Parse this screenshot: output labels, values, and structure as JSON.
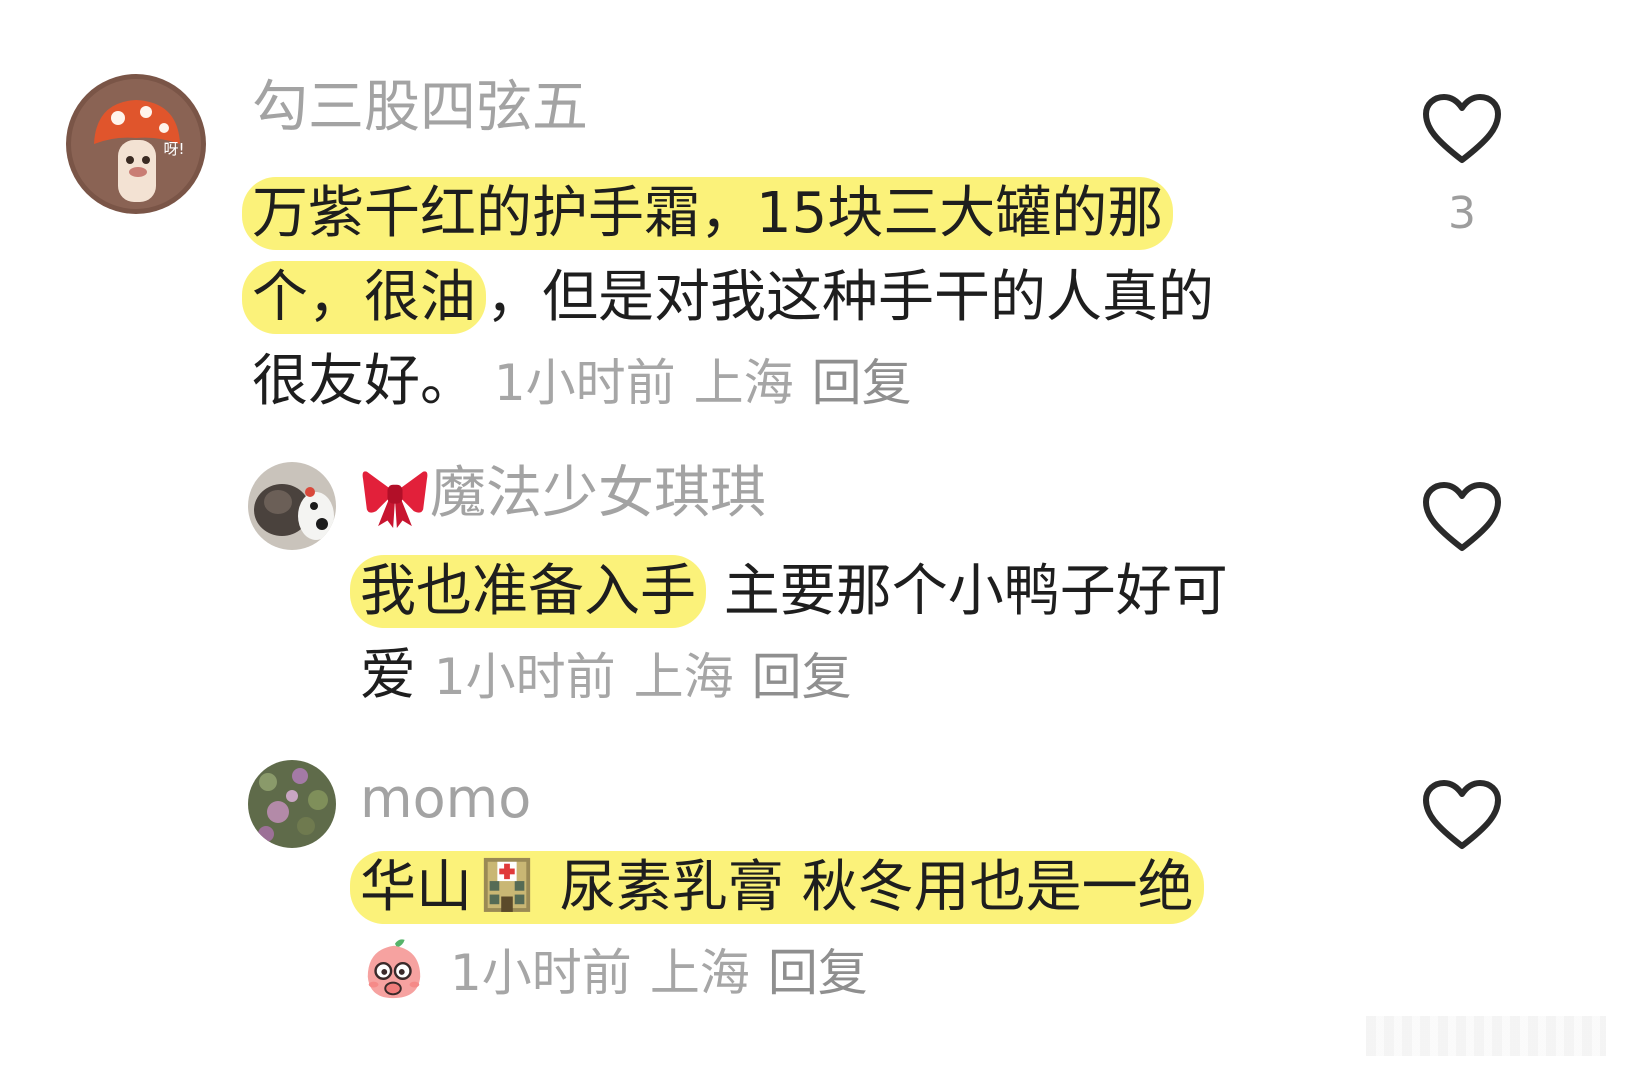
{
  "comments": [
    {
      "username": "勾三股四弦五",
      "text_highlighted_1": "万紫千红的护手霜，15块三大罐的那",
      "text_highlighted_2": "个，很油",
      "text_rest": "，但是对我这种手干的人真的",
      "text_line3": "很友好。",
      "time": "1小时前",
      "location": "上海",
      "reply_label": "回复",
      "like_count": "3",
      "avatar_text": "呀!"
    },
    {
      "username_emoji": "🎀",
      "username": "魔法少女琪琪",
      "text_highlighted": "我也准备入手",
      "text_rest": " 主要那个小鸭子好可",
      "text_line2": "爱",
      "time": "1小时前",
      "location": "上海",
      "reply_label": "回复",
      "like_count": ""
    },
    {
      "username": "momo",
      "text_part1": "华山",
      "text_part2": " 尿素乳膏 秋冬用也是一绝",
      "time": "1小时前",
      "location": "上海",
      "reply_label": "回复",
      "like_count": ""
    }
  ],
  "icons": {
    "like": "heart-outline-icon",
    "hospital": "hospital-icon",
    "sticker": "peach-sticker-icon",
    "bow": "ribbon-bow-icon"
  },
  "colors": {
    "highlight": "#fbf27a",
    "username": "#a3a3a3",
    "meta": "#a6a6a6",
    "text": "#1e1e1e"
  }
}
